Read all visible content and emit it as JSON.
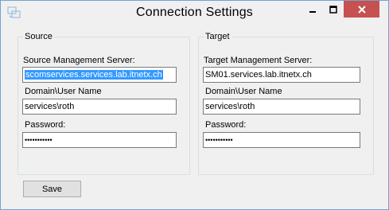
{
  "window": {
    "title": "Connection Settings",
    "icon": "app-icon",
    "close_color": "#c75050"
  },
  "source": {
    "group_label": "Source",
    "server_label": "Source Management Server:",
    "server_value": "scomservices.services.lab.itnetx.ch",
    "user_label": "Domain\\User Name",
    "user_value": "services\\roth",
    "password_label": "Password:",
    "password_value": "•••••••••••"
  },
  "target": {
    "group_label": "Target",
    "server_label": "Target Management Server:",
    "server_value": "SM01.services.lab.itnetx.ch",
    "user_label": "Domain\\User Name",
    "user_value": "services\\roth",
    "password_label": "Password:",
    "password_value": "•••••••••••"
  },
  "actions": {
    "save_label": "Save"
  }
}
